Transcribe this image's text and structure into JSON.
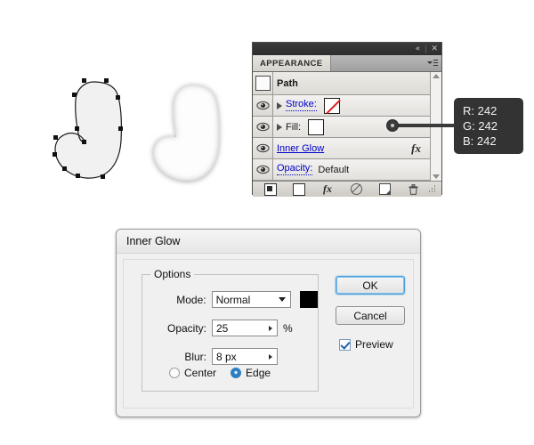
{
  "panel": {
    "titlebar": {
      "collapse_icon": "collapse-double-arrow-icon",
      "close_icon": "close-icon",
      "collapse_glyph": "«",
      "close_glyph": "✕",
      "separator": "|"
    },
    "tab_label": "APPEARANCE",
    "menu_icon": "panel-menu-icon",
    "rows": [
      {
        "kind": "header",
        "label": "Path",
        "thumb": "path-thumbnail",
        "has_eye": false,
        "has_disclosure": false
      },
      {
        "kind": "attribute",
        "label": "Stroke:",
        "link_style": "dotted",
        "has_eye": true,
        "has_disclosure": true,
        "swatch": "none",
        "value": ""
      },
      {
        "kind": "attribute",
        "label": "Fill:",
        "link_style": "plain",
        "has_eye": true,
        "has_disclosure": true,
        "swatch": "white",
        "value": ""
      },
      {
        "kind": "effect",
        "label": "Inner Glow",
        "link_style": "solid",
        "has_eye": true,
        "has_disclosure": false,
        "fx_label": "fx"
      },
      {
        "kind": "attribute",
        "label": "Opacity:",
        "link_style": "dotted",
        "has_eye": true,
        "has_disclosure": false,
        "value": "Default"
      }
    ],
    "scrollbar": {
      "up_icon": "scroll-up-arrow-icon",
      "down_icon": "scroll-down-arrow-icon"
    },
    "footer_buttons": [
      {
        "name": "add-new-stroke-button",
        "icon": "filled-square-icon"
      },
      {
        "name": "add-new-fill-button",
        "icon": "empty-square-icon"
      },
      {
        "name": "add-new-effect-button",
        "icon": "fx-icon",
        "label": "fx"
      },
      {
        "name": "clear-appearance-button",
        "icon": "circle-slash-icon"
      },
      {
        "name": "duplicate-item-button",
        "icon": "duplicate-icon"
      },
      {
        "name": "delete-item-button",
        "icon": "trash-icon"
      }
    ]
  },
  "tooltip": {
    "r": "R: 242",
    "g": "G: 242",
    "b": "B: 242",
    "background": "#333333",
    "text_color": "#f2f2f2"
  },
  "dialog": {
    "title": "Inner Glow",
    "group_label": "Options",
    "fields": {
      "mode_label": "Mode:",
      "mode_value": "Normal",
      "color_swatch": "#000000",
      "opacity_label": "Opacity:",
      "opacity_value": "25",
      "opacity_suffix": "%",
      "blur_label": "Blur:",
      "blur_value": "8 px"
    },
    "radios": [
      {
        "label": "Center",
        "selected": false
      },
      {
        "label": "Edge",
        "selected": true
      }
    ],
    "buttons": {
      "ok": "OK",
      "cancel": "Cancel"
    },
    "preview": {
      "label": "Preview",
      "checked": true
    }
  },
  "artwork": {
    "path_shape_name": "vector-path-with-anchor-points",
    "glow_shape_name": "shape-with-inner-glow",
    "fill_color": "#f2f2f2",
    "stroke_color": "#1a1a1a"
  }
}
